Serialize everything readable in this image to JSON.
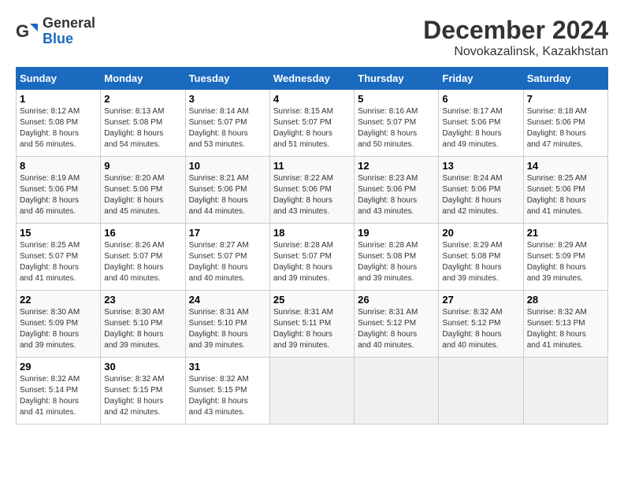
{
  "header": {
    "logo_general": "General",
    "logo_blue": "Blue",
    "month_year": "December 2024",
    "location": "Novokazalinsk, Kazakhstan"
  },
  "weekdays": [
    "Sunday",
    "Monday",
    "Tuesday",
    "Wednesday",
    "Thursday",
    "Friday",
    "Saturday"
  ],
  "weeks": [
    [
      {
        "day": "1",
        "sunrise": "8:12 AM",
        "sunset": "5:08 PM",
        "daylight": "8 hours and 56 minutes."
      },
      {
        "day": "2",
        "sunrise": "8:13 AM",
        "sunset": "5:08 PM",
        "daylight": "8 hours and 54 minutes."
      },
      {
        "day": "3",
        "sunrise": "8:14 AM",
        "sunset": "5:07 PM",
        "daylight": "8 hours and 53 minutes."
      },
      {
        "day": "4",
        "sunrise": "8:15 AM",
        "sunset": "5:07 PM",
        "daylight": "8 hours and 51 minutes."
      },
      {
        "day": "5",
        "sunrise": "8:16 AM",
        "sunset": "5:07 PM",
        "daylight": "8 hours and 50 minutes."
      },
      {
        "day": "6",
        "sunrise": "8:17 AM",
        "sunset": "5:06 PM",
        "daylight": "8 hours and 49 minutes."
      },
      {
        "day": "7",
        "sunrise": "8:18 AM",
        "sunset": "5:06 PM",
        "daylight": "8 hours and 47 minutes."
      }
    ],
    [
      {
        "day": "8",
        "sunrise": "8:19 AM",
        "sunset": "5:06 PM",
        "daylight": "8 hours and 46 minutes."
      },
      {
        "day": "9",
        "sunrise": "8:20 AM",
        "sunset": "5:06 PM",
        "daylight": "8 hours and 45 minutes."
      },
      {
        "day": "10",
        "sunrise": "8:21 AM",
        "sunset": "5:06 PM",
        "daylight": "8 hours and 44 minutes."
      },
      {
        "day": "11",
        "sunrise": "8:22 AM",
        "sunset": "5:06 PM",
        "daylight": "8 hours and 43 minutes."
      },
      {
        "day": "12",
        "sunrise": "8:23 AM",
        "sunset": "5:06 PM",
        "daylight": "8 hours and 43 minutes."
      },
      {
        "day": "13",
        "sunrise": "8:24 AM",
        "sunset": "5:06 PM",
        "daylight": "8 hours and 42 minutes."
      },
      {
        "day": "14",
        "sunrise": "8:25 AM",
        "sunset": "5:06 PM",
        "daylight": "8 hours and 41 minutes."
      }
    ],
    [
      {
        "day": "15",
        "sunrise": "8:25 AM",
        "sunset": "5:07 PM",
        "daylight": "8 hours and 41 minutes."
      },
      {
        "day": "16",
        "sunrise": "8:26 AM",
        "sunset": "5:07 PM",
        "daylight": "8 hours and 40 minutes."
      },
      {
        "day": "17",
        "sunrise": "8:27 AM",
        "sunset": "5:07 PM",
        "daylight": "8 hours and 40 minutes."
      },
      {
        "day": "18",
        "sunrise": "8:28 AM",
        "sunset": "5:07 PM",
        "daylight": "8 hours and 39 minutes."
      },
      {
        "day": "19",
        "sunrise": "8:28 AM",
        "sunset": "5:08 PM",
        "daylight": "8 hours and 39 minutes."
      },
      {
        "day": "20",
        "sunrise": "8:29 AM",
        "sunset": "5:08 PM",
        "daylight": "8 hours and 39 minutes."
      },
      {
        "day": "21",
        "sunrise": "8:29 AM",
        "sunset": "5:09 PM",
        "daylight": "8 hours and 39 minutes."
      }
    ],
    [
      {
        "day": "22",
        "sunrise": "8:30 AM",
        "sunset": "5:09 PM",
        "daylight": "8 hours and 39 minutes."
      },
      {
        "day": "23",
        "sunrise": "8:30 AM",
        "sunset": "5:10 PM",
        "daylight": "8 hours and 39 minutes."
      },
      {
        "day": "24",
        "sunrise": "8:31 AM",
        "sunset": "5:10 PM",
        "daylight": "8 hours and 39 minutes."
      },
      {
        "day": "25",
        "sunrise": "8:31 AM",
        "sunset": "5:11 PM",
        "daylight": "8 hours and 39 minutes."
      },
      {
        "day": "26",
        "sunrise": "8:31 AM",
        "sunset": "5:12 PM",
        "daylight": "8 hours and 40 minutes."
      },
      {
        "day": "27",
        "sunrise": "8:32 AM",
        "sunset": "5:12 PM",
        "daylight": "8 hours and 40 minutes."
      },
      {
        "day": "28",
        "sunrise": "8:32 AM",
        "sunset": "5:13 PM",
        "daylight": "8 hours and 41 minutes."
      }
    ],
    [
      {
        "day": "29",
        "sunrise": "8:32 AM",
        "sunset": "5:14 PM",
        "daylight": "8 hours and 41 minutes."
      },
      {
        "day": "30",
        "sunrise": "8:32 AM",
        "sunset": "5:15 PM",
        "daylight": "8 hours and 42 minutes."
      },
      {
        "day": "31",
        "sunrise": "8:32 AM",
        "sunset": "5:15 PM",
        "daylight": "8 hours and 43 minutes."
      },
      null,
      null,
      null,
      null
    ]
  ]
}
